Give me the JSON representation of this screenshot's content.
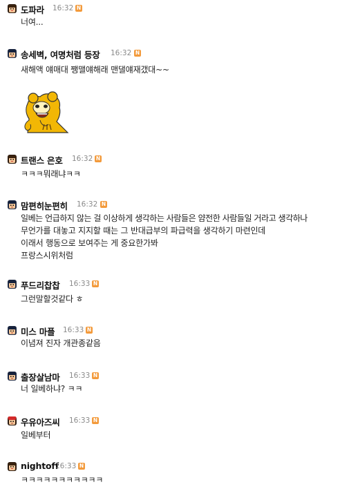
{
  "comments": [
    {
      "user": "도파라",
      "time": "16:32",
      "badge": "N",
      "avatar_icon": "avatar-girl-icon",
      "lines": [
        "너여..."
      ]
    },
    {
      "user": "송세벽, 여명처럼 등장",
      "time": "16:32",
      "badge": "N",
      "avatar_icon": "avatar-boy-icon",
      "lines": [
        "새해액 얘매대 쨍맬얘해래 맨댈얘재갰대~~"
      ],
      "sticker": "yellow-creature-sticker"
    },
    {
      "user": "트랜스 은호",
      "time": "16:32",
      "badge": "N",
      "avatar_icon": "avatar-girl-icon",
      "lines": [
        "ㅋㅋㅋ뭐래냐ㅋㅋ"
      ]
    },
    {
      "user": "맘편히눈편히",
      "time": "16:32",
      "badge": "N",
      "avatar_icon": "avatar-boy-icon",
      "lines": [
        "일베는 언급하지 않는 걸 이상하게 생각하는 사람들은 얌전한 사람들일 거라고 생각하나",
        "무언가를 대놓고 지지할 때는 그 반대급부의 파급력을 생각하기 마련인데",
        "이래서 행동으로 보여주는 게 중요한가봐",
        "프랑스시위처럼"
      ]
    },
    {
      "user": "푸드리찹찹",
      "time": "16:33",
      "badge": "N",
      "avatar_icon": "avatar-boy-icon",
      "lines": [
        "그런말할것같다 ㅎ"
      ]
    },
    {
      "user": "미스 마플",
      "time": "16:33",
      "badge": "N",
      "avatar_icon": "avatar-boy-icon",
      "lines": [
        "이념져 진자 개관종같음"
      ]
    },
    {
      "user": "출장살남마",
      "time": "16:33",
      "badge": "N",
      "avatar_icon": "avatar-boy-icon",
      "lines": [
        "너 일베하냐? ㅋㅋ"
      ]
    },
    {
      "user": "우유아즈씨",
      "time": "16:33",
      "badge": "N",
      "avatar_icon": "avatar-red-cap-icon",
      "lines": [
        "일베부터"
      ]
    },
    {
      "user": "nightoff",
      "time": "16:33",
      "badge": "N",
      "avatar_icon": "avatar-girl-icon",
      "lines": [
        "ㅋㅋㅋㅋㅋㅋㅋㅋㅋㅋㅋ"
      ]
    }
  ],
  "colors": {
    "badge": "#f39a3b",
    "time": "#8a8a8a",
    "text": "#222222"
  }
}
